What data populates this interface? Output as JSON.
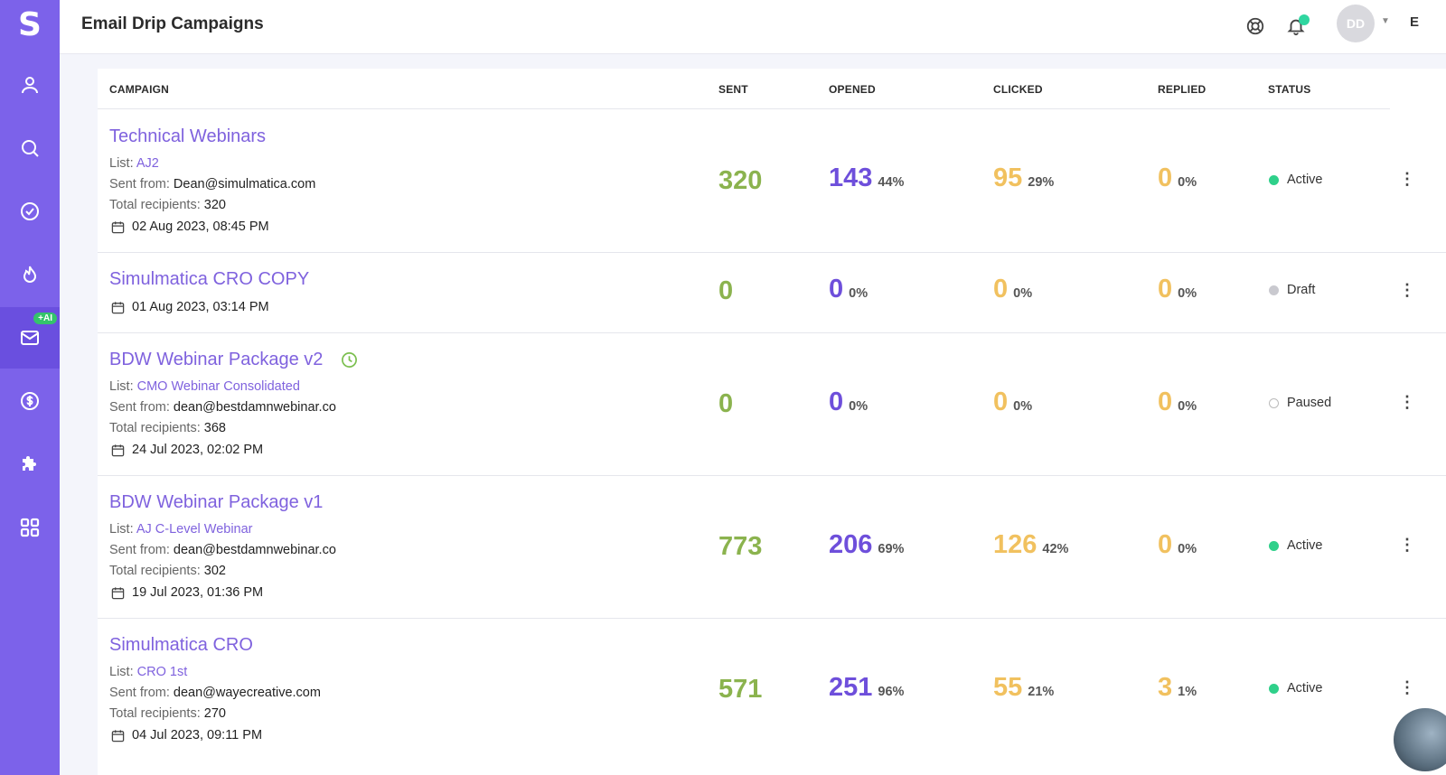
{
  "app": {
    "logo": "S",
    "title": "Email Drip Campaigns"
  },
  "sidebar": {
    "items": [
      {
        "name": "contacts",
        "icon": "user-icon"
      },
      {
        "name": "search",
        "icon": "search-icon"
      },
      {
        "name": "tasks",
        "icon": "check-circle-icon"
      },
      {
        "name": "hot",
        "icon": "flame-icon"
      },
      {
        "name": "email",
        "icon": "mail-icon",
        "badge": "+AI",
        "active": true
      },
      {
        "name": "billing",
        "icon": "dollar-icon"
      },
      {
        "name": "integrations",
        "icon": "puzzle-icon"
      },
      {
        "name": "apps",
        "icon": "grid-icon"
      }
    ]
  },
  "header": {
    "avatar_initials": "DD",
    "cut_text": "E"
  },
  "table": {
    "columns": [
      "CAMPAIGN",
      "SENT",
      "OPENED",
      "CLICKED",
      "REPLIED",
      "STATUS"
    ],
    "rows": [
      {
        "title": "Technical Webinars",
        "list_label": "List:",
        "list": "AJ2",
        "from_label": "Sent from:",
        "from": "Dean@simulmatica.com",
        "recip_label": "Total recipients:",
        "recipients": "320",
        "date": "02 Aug 2023, 08:45 PM",
        "sent": "320",
        "opened": "143",
        "opened_pct": "44%",
        "clicked": "95",
        "clicked_pct": "29%",
        "replied": "0",
        "replied_pct": "0%",
        "status": "Active"
      },
      {
        "title": "Simulmatica CRO COPY",
        "date": "01 Aug 2023, 03:14 PM",
        "sent": "0",
        "opened": "0",
        "opened_pct": "0%",
        "clicked": "0",
        "clicked_pct": "0%",
        "replied": "0",
        "replied_pct": "0%",
        "status": "Draft"
      },
      {
        "title": "BDW Webinar Package v2",
        "list_label": "List:",
        "list": "CMO Webinar Consolidated",
        "from_label": "Sent from:",
        "from": "dean@bestdamnwebinar.co",
        "recip_label": "Total recipients:",
        "recipients": "368",
        "date": "24 Jul 2023, 02:02 PM",
        "sent": "0",
        "opened": "0",
        "opened_pct": "0%",
        "clicked": "0",
        "clicked_pct": "0%",
        "replied": "0",
        "replied_pct": "0%",
        "status": "Paused"
      },
      {
        "title": "BDW Webinar Package v1",
        "list_label": "List:",
        "list": "AJ C-Level Webinar",
        "from_label": "Sent from:",
        "from": "dean@bestdamnwebinar.co",
        "recip_label": "Total recipients:",
        "recipients": "302",
        "date": "19 Jul 2023, 01:36 PM",
        "sent": "773",
        "opened": "206",
        "opened_pct": "69%",
        "clicked": "126",
        "clicked_pct": "42%",
        "replied": "0",
        "replied_pct": "0%",
        "status": "Active"
      },
      {
        "title": "Simulmatica CRO",
        "list_label": "List:",
        "list": "CRO 1st",
        "from_label": "Sent from:",
        "from": "dean@wayecreative.com",
        "recip_label": "Total recipients:",
        "recipients": "270",
        "date": "04 Jul 2023, 09:11 PM",
        "sent": "571",
        "opened": "251",
        "opened_pct": "96%",
        "clicked": "55",
        "clicked_pct": "21%",
        "replied": "3",
        "replied_pct": "1%",
        "status": "Active"
      }
    ]
  },
  "colors": {
    "sidebar": "#7c62ea",
    "link": "#7f62de",
    "sent": "#8bb34e",
    "opened": "#6e4fdb",
    "clicked": "#f1c15f",
    "active": "#2fd08a"
  }
}
